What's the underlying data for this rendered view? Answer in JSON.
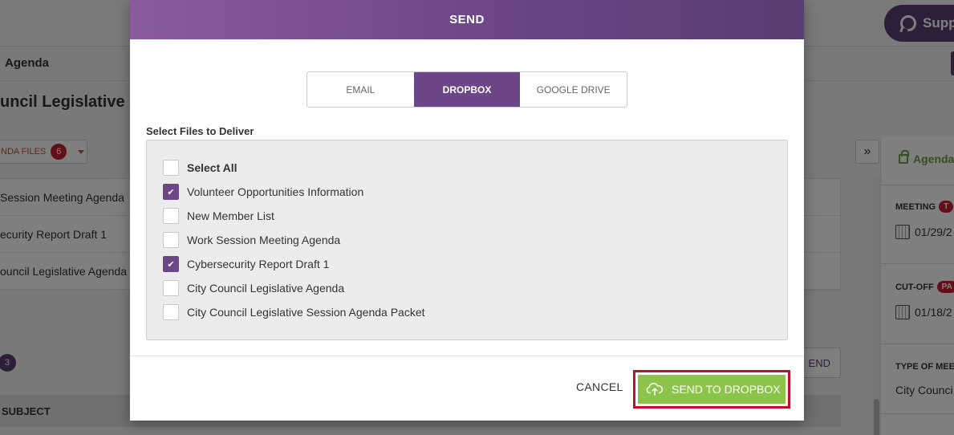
{
  "background": {
    "support_label": "Supp",
    "breadcrumb": "Agenda",
    "page_heading": "uncil Legislative Se",
    "files_button_label": "NDA FILES",
    "files_count": "6",
    "documents": [
      "Session Meeting Agenda",
      "ecurity Report Draft 1",
      "ouncil Legislative Agenda"
    ],
    "expand_label": "»",
    "sidebar": {
      "lock_label": "Agenda",
      "meeting_label": "MEETING",
      "meeting_pill": "T",
      "meeting_date": "01/29/2",
      "cutoff_label": "CUT-OFF",
      "cutoff_pill": "PA",
      "cutoff_date": "01/18/2",
      "type_label": "TYPE OF MEE",
      "type_value": "City Counci"
    },
    "count_badge": "3",
    "send_ghost_label": "END",
    "subject_header": "SUBJECT"
  },
  "modal": {
    "title": "SEND",
    "tabs": [
      {
        "label": "EMAIL",
        "active": false
      },
      {
        "label": "DROPBOX",
        "active": true
      },
      {
        "label": "GOOGLE DRIVE",
        "active": false
      }
    ],
    "section_label": "Select Files to Deliver",
    "select_all": {
      "label": "Select All",
      "checked": false
    },
    "files": [
      {
        "label": "Volunteer Opportunities Information",
        "checked": true
      },
      {
        "label": "New Member List",
        "checked": false
      },
      {
        "label": "Work Session Meeting Agenda",
        "checked": false
      },
      {
        "label": "Cybersecurity Report Draft 1",
        "checked": true
      },
      {
        "label": "City Council Legislative Agenda",
        "checked": false
      },
      {
        "label": "City Council Legislative Session Agenda Packet",
        "checked": false
      }
    ],
    "cancel_label": "CANCEL",
    "send_label": "SEND TO DROPBOX",
    "check_glyph": "✔"
  },
  "colors": {
    "header_purple": "#6c4687",
    "active_tab": "#6c4687",
    "send_green": "#8cc34a",
    "highlight_red": "#c0102a",
    "badge_red": "#c3202f"
  }
}
